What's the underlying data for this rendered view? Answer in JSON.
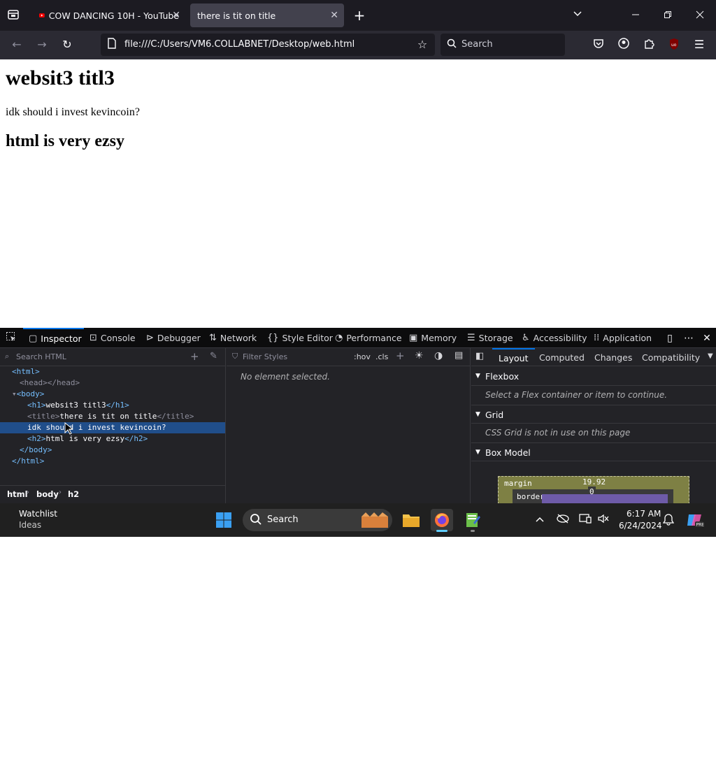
{
  "browser": {
    "tabs": [
      {
        "title": "COW DANCING 10H - YouTube",
        "active": false
      },
      {
        "title": "there is tit on title",
        "active": true
      }
    ],
    "url": "file:///C:/Users/VM6.COLLABNET/Desktop/web.html",
    "search_placeholder": "Search"
  },
  "page": {
    "h1": "websit3 titl3",
    "p": "idk should i invest kevincoin?",
    "h2": "html is very ezsy"
  },
  "devtools": {
    "tabs": [
      "Inspector",
      "Console",
      "Debugger",
      "Network",
      "Style Editor",
      "Performance",
      "Memory",
      "Storage",
      "Accessibility",
      "Application"
    ],
    "search_html_placeholder": "Search HTML",
    "filter_styles_placeholder": "Filter Styles",
    "hov": ":hov",
    "cls": ".cls",
    "no_element": "No element selected.",
    "layout_tabs": [
      "Layout",
      "Computed",
      "Changes",
      "Compatibility"
    ],
    "tree": {
      "html_open": "<html>",
      "head": "<head></head>",
      "body_open": "<body>",
      "h1_open": "<h1>",
      "h1_text": "websit3 titl3",
      "h1_close": "</h1>",
      "title_open": "<title>",
      "title_text": "there is tit on title",
      "title_close": "</title>",
      "text_node": "idk should i invest kevincoin?",
      "h2_open": "<h2>",
      "h2_text": "html is very ezsy",
      "h2_close": "</h2>",
      "body_close": "</body>",
      "html_close": "</html>"
    },
    "breadcrumbs": [
      "html",
      "body",
      "h2"
    ],
    "flexbox": {
      "title": "Flexbox",
      "message": "Select a Flex container or item to continue."
    },
    "grid": {
      "title": "Grid",
      "message": "CSS Grid is not in use on this page"
    },
    "box_model": {
      "title": "Box Model",
      "margin_label": "margin",
      "margin_value": "19.92",
      "border_label": "border",
      "border_value": "0"
    }
  },
  "taskbar": {
    "widget_title": "Watchlist",
    "widget_sub": "Ideas",
    "search_label": "Search",
    "time": "6:17 AM",
    "date": "6/24/2024"
  },
  "colors": {
    "accent": "#0074e8",
    "selected_row": "#204e8a",
    "box_margin": "#7e8044",
    "box_border": "#6e5ba8"
  }
}
